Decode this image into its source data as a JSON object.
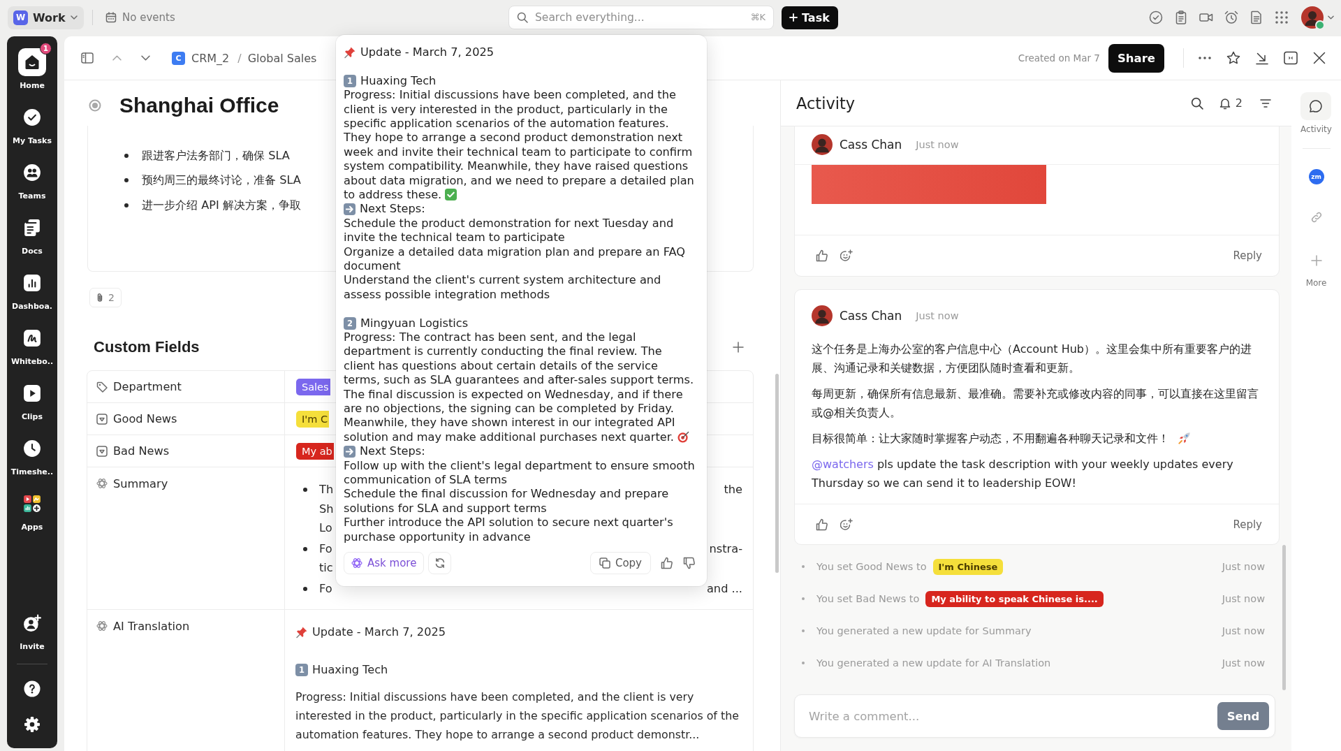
{
  "topbar": {
    "workspace": {
      "initial": "W",
      "name": "Work"
    },
    "calendar": "No events",
    "search": {
      "placeholder": "Search everything...",
      "shortcut": "⌘K"
    },
    "new_task": "Task",
    "user": {
      "online": true
    }
  },
  "sidebar": {
    "items": [
      {
        "kind": "home",
        "label": "Home",
        "badge": "1",
        "selected": true
      },
      {
        "kind": "tasks",
        "label": "My Tasks",
        "selected": false
      },
      {
        "kind": "teams",
        "label": "Teams",
        "selected": false
      },
      {
        "kind": "docs",
        "label": "Docs",
        "selected": false
      },
      {
        "kind": "dashboards",
        "label": "Dashboa.",
        "selected": false
      },
      {
        "kind": "whiteboards",
        "label": "Whitebo..",
        "selected": false
      },
      {
        "kind": "clips",
        "label": "Clips",
        "selected": false
      },
      {
        "kind": "timesheets",
        "label": "Timeshe..",
        "selected": false
      },
      {
        "kind": "apps",
        "label": "Apps",
        "selected": false
      }
    ],
    "invite": "Invite"
  },
  "task_header": {
    "breadcrumb": {
      "separator": "/",
      "items": [
        {
          "initial": "C",
          "label": "CRM_2"
        },
        {
          "label": "Global Sales"
        }
      ]
    },
    "created": "Created on Mar 7",
    "share": "Share"
  },
  "task": {
    "title": "Shanghai Office",
    "description_bullets": [
      "跟进客户法务部门，确保 SLA",
      "预约周三的最终讨论，准备 SLA",
      "进一步介绍 API 解决方案，争取"
    ],
    "attachments": "2"
  },
  "custom_fields": {
    "title": "Custom Fields",
    "fields": [
      {
        "kind": "label",
        "name": "Department",
        "option": {
          "text": "Sales",
          "color": "#7b68ee"
        }
      },
      {
        "kind": "dropdown",
        "name": "Good News",
        "option": {
          "text": "I'm C",
          "color": "#f5df3b"
        }
      },
      {
        "kind": "dropdown",
        "name": "Bad News",
        "option": {
          "text": "My ab",
          "color": "#d7261e"
        }
      },
      {
        "kind": "ai_summary",
        "name": "Summary",
        "bullets": [
          {
            "lines": [
              {
                "start": "Th",
                "end": "the"
              },
              {
                "start": "Sh"
              },
              {
                "start": "Lo"
              }
            ]
          },
          {
            "lines": [
              {
                "start": "Fo",
                "end": "nstra-"
              },
              {
                "start": "tic"
              }
            ]
          },
          {
            "lines": [
              {
                "start": "Fo",
                "end": "and ..."
              }
            ]
          }
        ]
      },
      {
        "kind": "ai_text",
        "name": "AI Translation",
        "heading": "Update - March 7, 2025",
        "number": "1",
        "subheading": "Huaxing Tech",
        "text": "Progress: Initial discussions have been completed, and the client is very interested in the product, particularly in the specific application scenarios of the automation features. They hope to arrange a second product demonstr..."
      }
    ]
  },
  "popover": {
    "heading": "Update - March 7, 2025",
    "sections": [
      {
        "number": "1",
        "title": "Huaxing Tech",
        "kind": "check",
        "progress": "Progress: Initial discussions have been completed, and the client is very interested in the product, particularly in the specific application scenarios of the automation features. They hope to arrange a second product demonstration next week and invite their technical team to participate to confirm system compatibility. Meanwhile, they have raised questions about data migration, and we need to prepare a detailed plan to address these.",
        "steps_label": "Next Steps:",
        "steps": [
          "Schedule the product demonstration for next Tuesday and invite the technical team to participate",
          "Organize a detailed data migration plan and prepare an FAQ document",
          "Understand the client's current system architecture and assess possible integration methods"
        ]
      },
      {
        "number": "2",
        "title": "Mingyuan Logistics",
        "kind": "target",
        "progress": "Progress: The contract has been sent, and the legal department is currently conducting the final review. The client has questions about certain details of the service terms, such as SLA guarantees and after-sales support terms. The final discussion is expected on Wednesday, and if there are no objections, the signing can be completed by Friday. Meanwhile, they have shown interest in our integrated API solution and may make additional purchases next quarter.",
        "steps_label": "Next Steps:",
        "steps": [
          "Follow up with the client's legal department to ensure smooth communication of SLA terms",
          "Schedule the final discussion for Wednesday and prepare solutions for SLA and support terms",
          "Further introduce the API solution to secure next quarter's purchase opportunity in advance"
        ]
      }
    ],
    "ask_more": "Ask more",
    "copy": "Copy"
  },
  "activity": {
    "title": "Activity",
    "notifications": "2",
    "comments": [
      {
        "kind": "image",
        "author": "Cass Chan",
        "time": "Just now",
        "reply": "Reply"
      },
      {
        "kind": "text",
        "author": "Cass Chan",
        "time": "Just now",
        "paragraphs": [
          {
            "kind": "plain",
            "text": "这个任务是上海办公室的客户信息中心（Account Hub）。这里会集中所有重要客户的进展、沟通记录和关键数据，方便团队随时查看和更新。"
          },
          {
            "kind": "plain",
            "text": "每周更新，确保所有信息最新、最准确。需要补充或修改内容的同事，可以直接在这里留言或@相关负责人。"
          },
          {
            "kind": "rocket",
            "text": "目标很简单：让大家随时掌握客户动态，不用翻遍各种聊天记录和文件！"
          },
          {
            "kind": "mention",
            "mention": "@watchers",
            "text": "pls update the task description with your weekly updates every Thursday so we can send it to leadership EOW!"
          }
        ],
        "reply": "Reply"
      }
    ],
    "log": [
      {
        "text": "You set Good News to",
        "option": {
          "text": "I'm Chinese",
          "color": "#f5df3b"
        },
        "time": "Just now"
      },
      {
        "text": "You set Bad News to",
        "option": {
          "text": "My ability to speak Chinese is....",
          "color": "#d7261e"
        },
        "time": "Just now"
      },
      {
        "text": "You generated a new update for Summary",
        "time": "Just now"
      },
      {
        "text": "You generated a new update for AI Translation",
        "time": "Just now"
      }
    ],
    "composer": {
      "placeholder": "Write a comment...",
      "send": {
        "label": "Send",
        "disabled": true
      }
    }
  },
  "right_rail": {
    "items": [
      {
        "kind": "activity",
        "label": "Activity",
        "selected": true
      },
      {
        "kind": "app",
        "initials": "zm",
        "selected": false
      },
      {
        "kind": "link",
        "selected": false
      },
      {
        "kind": "more",
        "label": "More",
        "selected": false
      }
    ]
  }
}
